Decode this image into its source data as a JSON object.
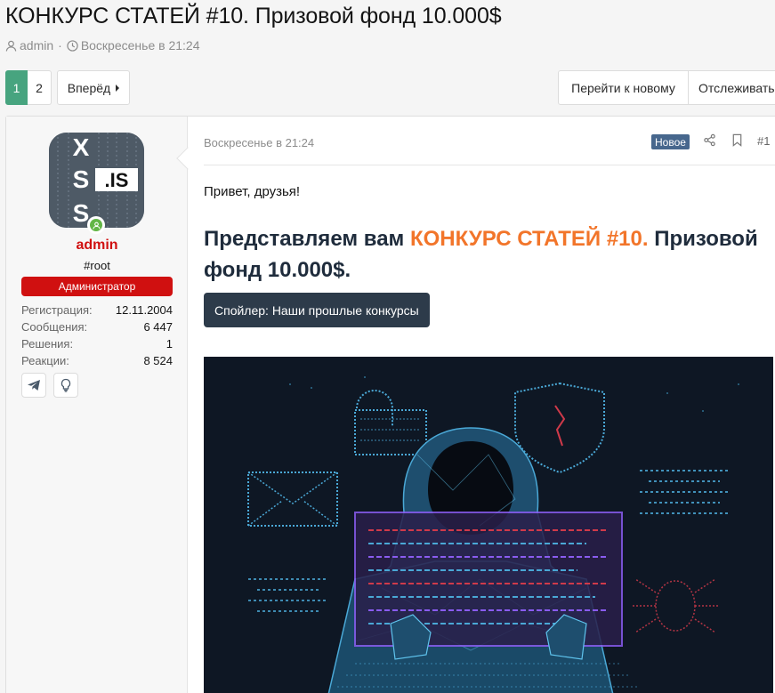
{
  "thread": {
    "title": "КОНКУРС СТАТЕЙ #10. Призовой фонд 10.000$",
    "author": "admin",
    "separator": "·",
    "date": "Воскресенье в 21:24"
  },
  "pagination": {
    "pages": [
      "1",
      "2"
    ],
    "current": "1",
    "next_label": "Вперёд"
  },
  "thread_actions": {
    "goto_new": "Перейти к новому",
    "watch": "Отслеживать"
  },
  "post": {
    "user": {
      "name": "admin",
      "title": "#root",
      "banner": "Администратор",
      "stats": [
        {
          "label": "Регистрация:",
          "value": "12.11.2004"
        },
        {
          "label": "Сообщения:",
          "value": "6 447"
        },
        {
          "label": "Решения:",
          "value": "1"
        },
        {
          "label": "Реакции:",
          "value": "8 524"
        }
      ],
      "avatar_text": ".IS"
    },
    "date": "Воскресенье в 21:24",
    "badge": "Новое",
    "number": "#1",
    "greeting": "Привет, друзья!",
    "headline_pre": "Представляем вам ",
    "headline_highlight": "КОНКУРС СТАТЕЙ #10.",
    "headline_post": " Призовой фонд 10.000$.",
    "spoiler_label": "Спойлер: Наши прошлые конкурсы"
  },
  "colors": {
    "accent_green": "#47a47f",
    "admin_red": "#d01010",
    "highlight_orange": "#f2752a",
    "badge_blue": "#47678d",
    "spoiler_dark": "#2d3b4a"
  }
}
